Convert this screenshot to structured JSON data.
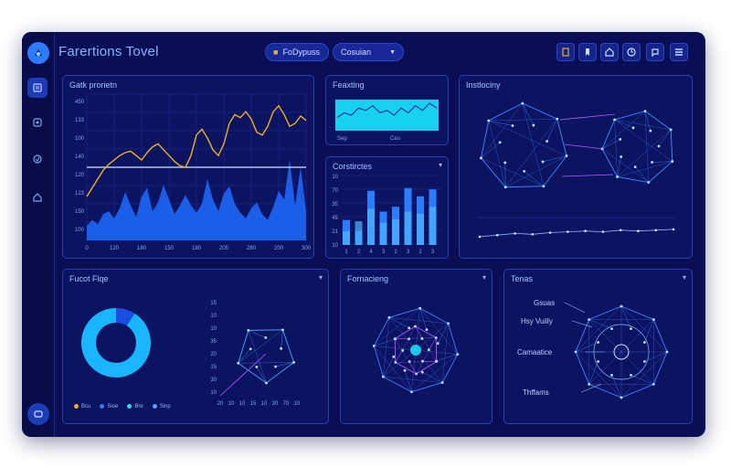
{
  "app": {
    "title": "Farertions Tovel"
  },
  "header": {
    "dropdown1": {
      "label": "FoDypuss"
    },
    "dropdown2": {
      "label": "Cosuian"
    },
    "toolbar_icons": [
      "file-icon",
      "bookmark-icon",
      "home-icon",
      "clock-icon",
      "chat-icon",
      "menu-icon"
    ]
  },
  "panels": {
    "main_chart": {
      "title": "Gatk prorietn"
    },
    "small_chart": {
      "title": "Feaxting"
    },
    "bar_chart": {
      "title": "Corstirctes"
    },
    "network_top": {
      "title": "Instlociny"
    },
    "donut": {
      "title": "Fucot Flqe"
    },
    "network_mid": {
      "title": "Fornacieng"
    },
    "network_right": {
      "title": "Tenas"
    }
  },
  "network_labels": [
    "Gsuas",
    "Hsy Vuiily",
    "Camaatice",
    "Thffams"
  ],
  "colors": {
    "accent": "#2f7bff",
    "line_orange": "#f0b020",
    "area_blue": "#1f6bff",
    "cyan": "#19e6ff",
    "violet": "#b45cff"
  },
  "chart_data": [
    {
      "type": "area",
      "title": "Gatk prorietn",
      "x": [
        0,
        1,
        2,
        3,
        4,
        5,
        6,
        7,
        8,
        9,
        10,
        11,
        12,
        13,
        14,
        15,
        16,
        17,
        18,
        19,
        20,
        21,
        22,
        23,
        24,
        25,
        26,
        27,
        28,
        29,
        30,
        31,
        32,
        33,
        34,
        35,
        36,
        37,
        38,
        39,
        40
      ],
      "y_ticks": [
        "450",
        "133",
        "100",
        "140",
        "120",
        "123",
        "150",
        "100"
      ],
      "x_ticks": [
        "0",
        "120",
        "180",
        "150",
        "180",
        "205",
        "280",
        "200",
        "300"
      ],
      "series": [
        {
          "values": [
            10,
            14,
            11,
            18,
            20,
            15,
            22,
            33,
            24,
            16,
            30,
            36,
            20,
            26,
            38,
            28,
            18,
            24,
            31,
            24,
            19,
            25,
            42,
            28,
            20,
            32,
            37,
            25,
            19,
            15,
            22,
            26,
            18,
            14,
            23,
            34,
            28,
            55,
            24,
            50,
            20
          ]
        },
        {
          "values": [
            30,
            36,
            42,
            48,
            52,
            55,
            58,
            60,
            61,
            58,
            55,
            60,
            64,
            66,
            62,
            58,
            54,
            51,
            50,
            58,
            72,
            76,
            70,
            62,
            58,
            66,
            80,
            86,
            84,
            88,
            83,
            74,
            72,
            78,
            88,
            92,
            86,
            78,
            80,
            85,
            82
          ]
        }
      ],
      "reference_line": 50
    },
    {
      "type": "line",
      "title": "Feaxting",
      "series": [
        {
          "values": [
            4,
            6,
            5,
            8,
            7,
            9,
            6,
            7,
            5,
            8,
            6,
            9,
            7,
            10,
            8
          ]
        }
      ],
      "x_ticks": [
        "Sep",
        "Ceu"
      ]
    },
    {
      "type": "bar",
      "title": "Corstirctes",
      "categories": [
        "1",
        "2",
        "3",
        "4",
        "5",
        "6",
        "7",
        "8"
      ],
      "series": [
        {
          "values": [
            20,
            34,
            52,
            32,
            37,
            48,
            45,
            55
          ]
        },
        {
          "values": [
            36,
            20,
            78,
            48,
            55,
            82,
            70,
            80
          ]
        }
      ],
      "y_ticks": [
        "10",
        "70",
        "35",
        "45",
        "21",
        "10"
      ],
      "x_ticks": [
        "1",
        "2",
        "4",
        "3",
        "2",
        "3",
        "2",
        "3"
      ]
    },
    {
      "type": "line",
      "title": "Instlociny",
      "series": [
        {
          "values": [
            10,
            12,
            14,
            13,
            15,
            16,
            17,
            16,
            18,
            17,
            18,
            19
          ]
        }
      ]
    },
    {
      "type": "pie",
      "title": "Fucot Flqe",
      "categories": [
        "Bcu",
        "Sioe",
        "Bre",
        "Sinp"
      ],
      "values": [
        9,
        91
      ],
      "legend": [
        "Bcu",
        "Sioe",
        "Bre",
        "Sinp"
      ]
    },
    {
      "type": "scatter",
      "title": "Fucot Flqe",
      "y_ticks": [
        "15",
        "10",
        "10",
        "35",
        "20",
        "15",
        "30",
        "10"
      ],
      "x_ticks": [
        "20",
        "10",
        "10",
        "15",
        "10",
        "30",
        "70",
        "10"
      ]
    }
  ]
}
